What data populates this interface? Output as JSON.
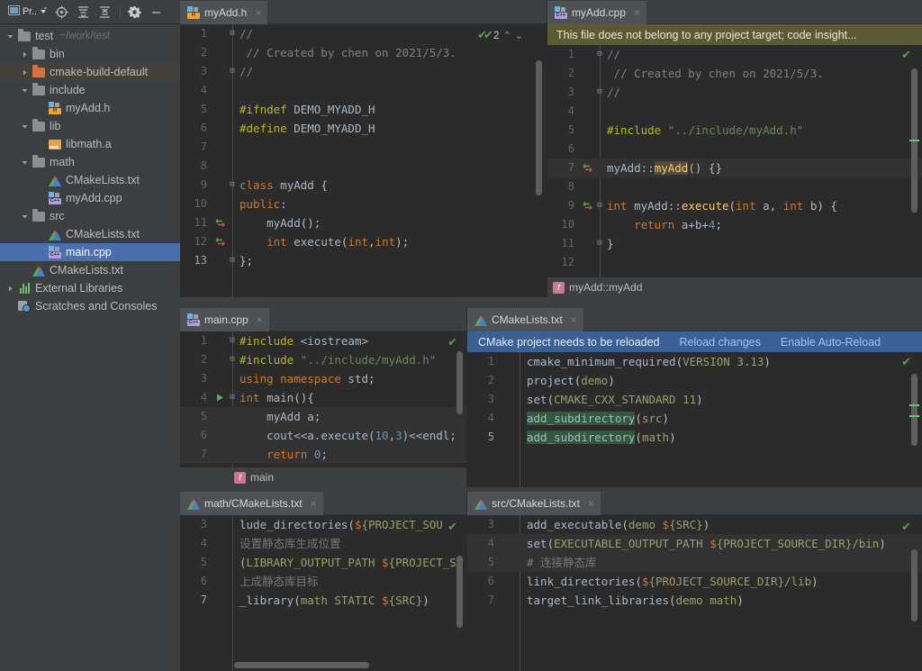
{
  "sidebar": {
    "toolbar": {
      "project_label": "Pr..",
      "buttons": [
        {
          "name": "project-panel-icon",
          "label": "Pr.."
        },
        {
          "name": "locate-icon",
          "label": "Select Opened File"
        },
        {
          "name": "collapse-all-icon",
          "label": "Collapse All"
        },
        {
          "name": "expand-all-icon",
          "label": "Expand All"
        },
        {
          "name": "gear-icon",
          "label": "Settings"
        },
        {
          "name": "minimize-icon",
          "label": "Hide"
        }
      ]
    },
    "tree": [
      {
        "label": "test",
        "suffix": "~/work/test",
        "icon": "folder",
        "indent": 0,
        "arrow": "down",
        "state": "normal"
      },
      {
        "label": "bin",
        "suffix": "",
        "icon": "folder",
        "indent": 1,
        "arrow": "right",
        "state": "normal"
      },
      {
        "label": "cmake-build-default",
        "suffix": "",
        "icon": "folder-orange",
        "indent": 1,
        "arrow": "right",
        "state": "hover"
      },
      {
        "label": "include",
        "suffix": "",
        "icon": "folder",
        "indent": 1,
        "arrow": "down",
        "state": "normal"
      },
      {
        "label": "myAdd.h",
        "suffix": "",
        "icon": "file-h",
        "indent": 2,
        "arrow": "none",
        "state": "normal"
      },
      {
        "label": "lib",
        "suffix": "",
        "icon": "folder",
        "indent": 1,
        "arrow": "down",
        "state": "normal"
      },
      {
        "label": "libmath.a",
        "suffix": "",
        "icon": "lib",
        "indent": 2,
        "arrow": "none",
        "state": "normal"
      },
      {
        "label": "math",
        "suffix": "",
        "icon": "folder",
        "indent": 1,
        "arrow": "down",
        "state": "normal"
      },
      {
        "label": "CMakeLists.txt",
        "suffix": "",
        "icon": "cmake",
        "indent": 2,
        "arrow": "none",
        "state": "normal"
      },
      {
        "label": "myAdd.cpp",
        "suffix": "",
        "icon": "file-cpp",
        "indent": 2,
        "arrow": "none",
        "state": "normal"
      },
      {
        "label": "src",
        "suffix": "",
        "icon": "folder",
        "indent": 1,
        "arrow": "down",
        "state": "normal"
      },
      {
        "label": "CMakeLists.txt",
        "suffix": "",
        "icon": "cmake",
        "indent": 2,
        "arrow": "none",
        "state": "normal"
      },
      {
        "label": "main.cpp",
        "suffix": "",
        "icon": "file-cpp",
        "indent": 2,
        "arrow": "none",
        "state": "selected"
      },
      {
        "label": "CMakeLists.txt",
        "suffix": "",
        "icon": "cmake",
        "indent": 1,
        "arrow": "none",
        "state": "normal"
      },
      {
        "label": "External Libraries",
        "suffix": "",
        "icon": "bars",
        "indent": 0,
        "arrow": "right",
        "state": "normal"
      },
      {
        "label": "Scratches and Consoles",
        "suffix": "",
        "icon": "scratch",
        "indent": 0,
        "arrow": "none",
        "state": "normal"
      }
    ]
  },
  "panes": {
    "myadd_h": {
      "tab": {
        "label": "myAdd.h",
        "icon": "file-h",
        "close": "×"
      },
      "inspection": {
        "count": "2",
        "ok_glyph": "✔✔",
        "up": "⌃",
        "down": "⌄"
      },
      "lines": [
        {
          "n": "1",
          "fold": "⊟",
          "html": "<span class='c-com'>//</span>"
        },
        {
          "n": "2",
          "fold": "",
          "html": "<span class='c-com'> // Created by chen on 2021/5/3.</span>"
        },
        {
          "n": "3",
          "fold": "⊟",
          "html": "<span class='c-com'>//</span>"
        },
        {
          "n": "4",
          "fold": "",
          "html": ""
        },
        {
          "n": "5",
          "fold": "",
          "html": "<span class='c-pp'>#ifndef</span> <span class='c-def'>DEMO_MYADD_H</span>"
        },
        {
          "n": "6",
          "fold": "",
          "html": "<span class='c-pp'>#define</span> <span class='c-def'>DEMO_MYADD_H</span>"
        },
        {
          "n": "7",
          "fold": "",
          "html": ""
        },
        {
          "n": "8",
          "fold": "",
          "html": ""
        },
        {
          "n": "9",
          "fold": "⊟",
          "html": "<span class='c-kw'>class</span> <span class='c-def'>myAdd</span> {"
        },
        {
          "n": "10",
          "fold": "",
          "html": "<span class='c-kw'>public</span><span class='c-def'>:</span>"
        },
        {
          "n": "11",
          "fold": "",
          "mark": "impl",
          "html": "    <span class='c-def'>myAdd</span>();"
        },
        {
          "n": "12",
          "fold": "",
          "mark": "impl",
          "html": "    <span class='c-kw'>int</span> <span class='c-def'>execute</span>(<span class='c-kw'>int</span>,<span class='c-kw'>int</span>);"
        },
        {
          "n": "13",
          "fold": "⊟",
          "cur": true,
          "html": "};"
        }
      ]
    },
    "myadd_cpp": {
      "tab": {
        "label": "myAdd.cpp",
        "icon": "file-cpp",
        "close": "×"
      },
      "warning_banner": "This file does not belong to any project target; code insight...",
      "ok_glyph": "✔",
      "lines": [
        {
          "n": "1",
          "fold": "⊟",
          "html": "<span class='c-com'>//</span>"
        },
        {
          "n": "2",
          "fold": "",
          "html": "<span class='c-com'> // Created by chen on 2021/5/3.</span>"
        },
        {
          "n": "3",
          "fold": "⊟",
          "html": "<span class='c-com'>//</span>"
        },
        {
          "n": "4",
          "fold": "",
          "html": ""
        },
        {
          "n": "5",
          "fold": "",
          "html": "<span class='c-pp'>#include</span> <span class='c-str'>\"../include/myAdd.h\"</span>"
        },
        {
          "n": "6",
          "fold": "",
          "html": ""
        },
        {
          "n": "7",
          "fold": "",
          "mark": "impl",
          "hl": true,
          "html": "<span class='c-def'>myAdd</span>::<span class='hlwarn c-fn'>myAdd</span>() {}"
        },
        {
          "n": "8",
          "fold": "",
          "html": ""
        },
        {
          "n": "9",
          "fold": "⊟",
          "mark": "impl",
          "html": "<span class='c-kw'>int</span> <span class='c-def'>myAdd</span>::<span class='c-fn'>execute</span>(<span class='c-kw'>int</span> <span class='c-def'>a</span>, <span class='c-kw'>int</span> <span class='c-def'>b</span>) {"
        },
        {
          "n": "10",
          "fold": "",
          "html": "    <span class='c-kw'>return</span> <span class='c-def'>a+b+</span><span class='c-num'>4</span>;"
        },
        {
          "n": "11",
          "fold": "⊟",
          "html": "}"
        },
        {
          "n": "12",
          "fold": "",
          "html": ""
        }
      ],
      "breadcrumb": {
        "icon": "f",
        "label": "myAdd::myAdd"
      }
    },
    "main_cpp": {
      "tab": {
        "label": "main.cpp",
        "icon": "file-cpp",
        "close": "×"
      },
      "ok_glyph": "✔",
      "lines": [
        {
          "n": "1",
          "fold": "⊟",
          "html": "<span class='c-pp'>#include</span> <span class='c-def'>&lt;iostream&gt;</span>"
        },
        {
          "n": "2",
          "fold": "⊟",
          "html": "<span class='c-pp'>#include</span> <span class='c-str'>\"../include/myAdd.h\"</span>"
        },
        {
          "n": "3",
          "fold": "",
          "html": "<span class='c-kw'>using namespace</span> <span class='c-def'>std</span>;"
        },
        {
          "n": "4",
          "fold": "⊟",
          "mark": "run",
          "html": "<span class='c-kw'>int</span> <span class='c-def'>main</span>(){"
        },
        {
          "n": "5",
          "fold": "",
          "hl": true,
          "html": "    <span class='c-def'>myAdd a</span>;"
        },
        {
          "n": "6",
          "fold": "",
          "hl": true,
          "html": "    <span class='c-def'>cout&lt;&lt;a.execute(</span><span class='c-num'>10</span><span class='c-def'>,</span><span class='c-num'>3</span><span class='c-def'>)&lt;&lt;endl</span>;"
        },
        {
          "n": "7",
          "fold": "",
          "hl": true,
          "html": "    <span class='c-kw'>return</span> <span class='c-num'>0</span>;"
        }
      ],
      "breadcrumb": {
        "icon": "f",
        "label": "main"
      }
    },
    "cmake_root": {
      "tab": {
        "label": "CMakeLists.txt",
        "icon": "cmake",
        "close": "×"
      },
      "info_banner": {
        "message": "CMake project needs to be reloaded",
        "reload": "Reload changes",
        "autoreload": "Enable Auto-Reload"
      },
      "ok_glyph": "✔",
      "lines": [
        {
          "n": "1",
          "html": "<span class='c-cm1'>cmake_minimum_required</span>(<span class='c-cmarg'>VERSION 3.13</span>)"
        },
        {
          "n": "2",
          "html": "<span class='c-cm1'>project</span>(<span class='c-cmarg'>demo</span>)"
        },
        {
          "n": "3",
          "html": "<span class='c-cm1'>set</span>(<span class='c-cmarg'>CMAKE_CXX_STANDARD 11</span>)"
        },
        {
          "n": "4",
          "html": "<span class='hlgreen c-cm1'>add_subdirectory</span>(<span class='c-cmarg'>src</span>)"
        },
        {
          "n": "5",
          "cur": true,
          "html": "<span class='hlgreen c-cm1'>add_subdirectory</span>(<span class='c-cmarg'>math</span>)"
        }
      ]
    },
    "cmake_math": {
      "tab": {
        "label": "math/CMakeLists.txt",
        "icon": "cmake",
        "close": "×"
      },
      "ok_glyph": "✔",
      "lines": [
        {
          "n": "3",
          "html": "<span class='c-cm1'>lude_directories</span>(<span class='c-var'>$</span><span class='c-cmarg'>{PROJECT_SOU</span>"
        },
        {
          "n": "4",
          "html": "<span class='c-gray'>设置静态库生成位置</span>"
        },
        {
          "n": "5",
          "html": "<span class='c-cm1'>(</span><span class='c-cmarg'>LIBRARY_OUTPUT_PATH </span><span class='c-var'>$</span><span class='c-cmarg'>{PROJECT_SO</span>"
        },
        {
          "n": "6",
          "html": "<span class='c-gray'>上成静态库目标</span>"
        },
        {
          "n": "7",
          "cur": true,
          "html": "<span class='c-cm1'>_library</span>(<span class='c-cmarg'>math STATIC </span><span class='c-var'>$</span><span class='c-cmarg'>{SRC}</span>)"
        }
      ]
    },
    "cmake_src": {
      "tab": {
        "label": "src/CMakeLists.txt",
        "icon": "cmake",
        "close": "×"
      },
      "ok_glyph": "✔",
      "lines": [
        {
          "n": "3",
          "html": "<span class='c-cm1'>add_executable</span>(<span class='c-cmarg'>demo </span><span class='c-var'>$</span><span class='c-cmarg'>{SRC}</span>)"
        },
        {
          "n": "4",
          "hl": true,
          "html": "<span class='c-cm1'>set</span>(<span class='c-cmarg'>EXECUTABLE_OUTPUT_PATH </span><span class='c-var'>$</span><span class='c-cmarg'>{PROJECT_SOURCE_DIR}</span><span class='c-cmarg'>/bin</span>)"
        },
        {
          "n": "5",
          "hl": true,
          "html": "<span class='c-gray'># 连接静态库</span>"
        },
        {
          "n": "6",
          "html": "<span class='c-cm1'>link_directories</span>(<span class='c-var'>$</span><span class='c-cmarg'>{PROJECT_SOURCE_DIR}</span><span class='c-cmarg'>/lib</span>)"
        },
        {
          "n": "7",
          "html": "<span class='c-cm1'>target_link_libraries</span>(<span class='c-cmarg'>demo math</span>)"
        }
      ]
    }
  },
  "colors": {
    "chrome": "#3c3f41",
    "editor_bg": "#2b2b2b",
    "selection": "#4b6eaf",
    "warn_banner": "#5b5a33",
    "info_banner": "#3a6095",
    "ok_green": "#5a9e4b"
  }
}
